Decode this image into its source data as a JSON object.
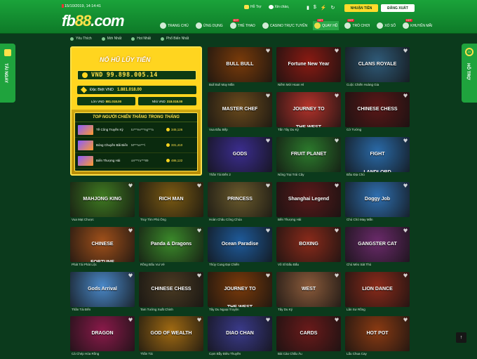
{
  "header": {
    "datetime": "15/10/2019, 14:14:41",
    "logo_text": "fb",
    "logo_num": "88",
    "logo_suffix": ".com",
    "support_label": "Hỗ Trợ",
    "greeting": "Xin chào,",
    "deposit_label": "NHUẬN TIỀN",
    "login_label": "ĐĂNG XUẤT",
    "nav": [
      {
        "label": "TRANG CHỦ",
        "badge": ""
      },
      {
        "label": "ỨNG DỤNG",
        "badge": ""
      },
      {
        "label": "THỂ THAO",
        "badge": "HOT"
      },
      {
        "label": "CASINO TRỰC TUYẾN",
        "badge": ""
      },
      {
        "label": "QUAY HŨ",
        "badge": "HOT"
      },
      {
        "label": "TRÒ CHƠI",
        "badge": "HOT"
      },
      {
        "label": "XỔ SỐ",
        "badge": ""
      },
      {
        "label": "KHUYẾN MÃI",
        "badge": "HOT"
      }
    ]
  },
  "filters": [
    "Yêu Thích",
    "Mới Nhất",
    "Hot Nhất",
    "Phổ Biến Nhất"
  ],
  "side": {
    "left": "TẢI NGAY",
    "right": "HỖ TRỢ",
    "right_badge": "24"
  },
  "jackpot": {
    "title": "NỔ HŨ LŨY TIẾN",
    "currency": "VND",
    "amount": "99.898.005.14",
    "special_label": "Đặc Biệt VND",
    "special_value": "1.881.018.00",
    "big_label": "Lớn VND",
    "big_value": "881.018.00",
    "small_label": "Nhỏ VND",
    "small_value": "318.018.00",
    "winners_title": "TOP NGƯỜI CHIẾN THẮNG TRONG THÁNG",
    "winners": [
      {
        "game": "Tề Công Truyền Kỳ",
        "user": "to***ev***ng***a",
        "amount": "345,126"
      },
      {
        "game": "Bóng Chuyền Bãi Biển",
        "user": "M***ve***i",
        "amount": "331,410"
      },
      {
        "game": "Biển Thượng Hải",
        "user": "on***ru***89",
        "amount": "486,122"
      }
    ]
  },
  "games": [
    {
      "name": "Bull Bull May Mắn",
      "art": "BULL BULL",
      "color": "#7a3b0a"
    },
    {
      "name": "Niềm Mới Hoan Hỉ",
      "art": "Fortune New Year",
      "color": "#8a1a12"
    },
    {
      "name": "Cuộc Chiến Hoàng Gia",
      "art": "CLANS ROYALE",
      "color": "#2f5a78"
    },
    {
      "name": "Vua Đầu Bếp",
      "art": "MASTER CHEF",
      "color": "#6a4a1c"
    },
    {
      "name": "Tấn Tây Du Ký",
      "art": "JOURNEY TO THE WEST",
      "color": "#b3322a"
    },
    {
      "name": "Cờ Tướng",
      "art": "CHINESE CHESS",
      "color": "#5a1717"
    },
    {
      "name": "Thần Tài Đến 2",
      "art": "GODS",
      "color": "#3b2d8f"
    },
    {
      "name": "Nông Trại Trái Cây",
      "art": "FRUIT PLANET",
      "color": "#2c7a2c"
    },
    {
      "name": "Đầu Địa Chủ",
      "art": "FIGHT LANDLORD",
      "color": "#2a6aa8"
    },
    {
      "name": "Vua Mạt Chược",
      "art": "MAHJONG KING",
      "color": "#3f7a21"
    },
    {
      "name": "Truy Tìm Phú Ông",
      "art": "RICH MAN",
      "color": "#7a5a12"
    },
    {
      "name": "Hoàn Châu Công Chúa",
      "art": "PRINCESS",
      "color": "#6a5a2c"
    },
    {
      "name": "Bến Thượng Hải",
      "art": "Shanghai Legend",
      "color": "#5a1a1a"
    },
    {
      "name": "Chú Chó May Mắn",
      "art": "Doggy Job",
      "color": "#2f6fb0"
    },
    {
      "name": "Phát Tài Phát Lộc",
      "art": "CHINESE FORTUNE",
      "color": "#a0501a"
    },
    {
      "name": "Rồng Đấu Vui Vẻ",
      "art": "Panda & Dragons",
      "color": "#3b8a2a"
    },
    {
      "name": "Thủy Cung Đại Chiến",
      "art": "Ocean Paradise",
      "color": "#1e5a9a"
    },
    {
      "name": "Võ Sĩ Đấu Đấu",
      "art": "BOXING",
      "color": "#8a2a1a"
    },
    {
      "name": "Chú Mèo Sát Thủ",
      "art": "GANGSTER CAT",
      "color": "#6a2a6a"
    },
    {
      "name": "Thần Tài Đến",
      "art": "Gods Arrival",
      "color": "#4a88c8"
    },
    {
      "name": "Tam Tướng Xuất Chinh",
      "art": "CHINESE CHESS",
      "color": "#4a3a22"
    },
    {
      "name": "Tây Du Ngoại Truyện",
      "art": "JOURNEY TO THE WEST",
      "color": "#7a3a0a"
    },
    {
      "name": "Tây Du Ký",
      "art": "WEST",
      "color": "#8a5a3a"
    },
    {
      "name": "Lân Sư Rồng",
      "art": "LION DANCE",
      "color": "#8a2a1a"
    },
    {
      "name": "Cá Chép Hóa Rồng",
      "art": "DRAGON",
      "color": "#8a1a4a"
    },
    {
      "name": "Thần Tài",
      "art": "GOD OF WEALTH",
      "color": "#a06a12"
    },
    {
      "name": "Cạm Bẫy Điêu Thuyền",
      "art": "DIAO CHAN",
      "color": "#3a3a8a"
    },
    {
      "name": "Bài Cào Chấu Âu",
      "art": "CARDS",
      "color": "#6a1a1a"
    },
    {
      "name": "Lẩu Chua Cay",
      "art": "HOT POT",
      "color": "#8a3a12"
    }
  ],
  "scroll_top": "↑"
}
